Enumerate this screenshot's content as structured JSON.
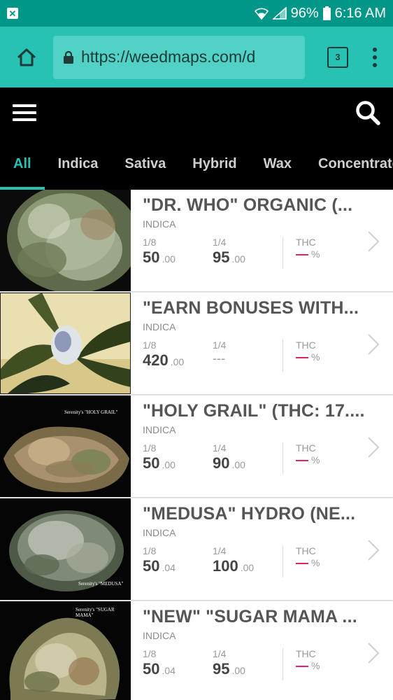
{
  "status_bar": {
    "battery": "96%",
    "time": "6:16 AM",
    "notification_icon": "close-notification-icon"
  },
  "browser": {
    "url": "https://weedmaps.com/d",
    "tab_count": "3"
  },
  "categories": [
    {
      "label": "All",
      "active": true
    },
    {
      "label": "Indica"
    },
    {
      "label": "Sativa"
    },
    {
      "label": "Hybrid"
    },
    {
      "label": "Wax"
    },
    {
      "label": "Concentrates"
    }
  ],
  "products": [
    {
      "name": "\"DR. WHO\" ORGANIC (...",
      "type": "INDICA",
      "eighth_label": "1/8",
      "eighth_main": "50",
      "eighth_cents": ".00",
      "quarter_label": "1/4",
      "quarter_main": "95",
      "quarter_cents": ".00",
      "thc_label": "THC",
      "thc_pct": "%",
      "caption": ""
    },
    {
      "name": "\"EARN BONUSES WITH...",
      "type": "INDICA",
      "eighth_label": "1/8",
      "eighth_main": "420",
      "eighth_cents": ".00",
      "quarter_label": "1/4",
      "quarter_main": "---",
      "quarter_cents": "",
      "thc_label": "THC",
      "thc_pct": "%",
      "caption": ""
    },
    {
      "name": "\"HOLY GRAIL\" (THC: 17....",
      "type": "INDICA",
      "eighth_label": "1/8",
      "eighth_main": "50",
      "eighth_cents": ".00",
      "quarter_label": "1/4",
      "quarter_main": "90",
      "quarter_cents": ".00",
      "thc_label": "THC",
      "thc_pct": "%",
      "caption": "Serenity's \"HOLY GRAIL\""
    },
    {
      "name": "\"MEDUSA\" HYDRO (NE...",
      "type": "INDICA",
      "eighth_label": "1/8",
      "eighth_main": "50",
      "eighth_cents": ".04",
      "quarter_label": "1/4",
      "quarter_main": "100",
      "quarter_cents": ".00",
      "thc_label": "THC",
      "thc_pct": "%",
      "caption": "Serenity's \"MEDUSA\""
    },
    {
      "name": "\"NEW\" \"SUGAR MAMA ...",
      "type": "INDICA",
      "eighth_label": "1/8",
      "eighth_main": "50",
      "eighth_cents": ".04",
      "quarter_label": "1/4",
      "quarter_main": "95",
      "quarter_cents": ".00",
      "thc_label": "THC",
      "thc_pct": "%",
      "caption": "Serenity's \"SUGAR MAMA\""
    }
  ],
  "colors": {
    "status_bar": "#009688",
    "browser_bar": "#27c2b4",
    "accent": "#27c2b4",
    "thc_dash": "#e0245e"
  }
}
